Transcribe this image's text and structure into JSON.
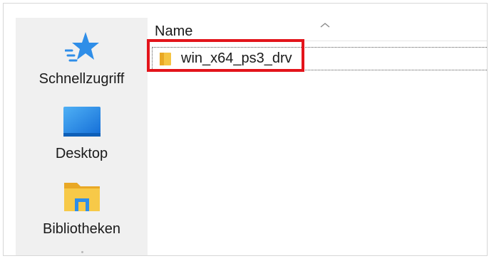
{
  "navigation_pane": {
    "items": [
      {
        "label": "Schnellzugriff",
        "icon": "star-icon"
      },
      {
        "label": "Desktop",
        "icon": "desktop-icon"
      },
      {
        "label": "Bibliotheken",
        "icon": "libraries-folder-icon"
      }
    ]
  },
  "file_list": {
    "column_header": "Name",
    "sort_indicator": "sort-ascending-icon",
    "rows": [
      {
        "name": "win_x64_ps3_drv",
        "icon": "folder-icon"
      }
    ]
  },
  "annotation": {
    "highlight_color": "#e3141b"
  },
  "colors": {
    "nav_background": "#f0f0f0",
    "star": "#2f8ee8",
    "desktop": "#1e88e5",
    "folder": "#f5c443"
  }
}
